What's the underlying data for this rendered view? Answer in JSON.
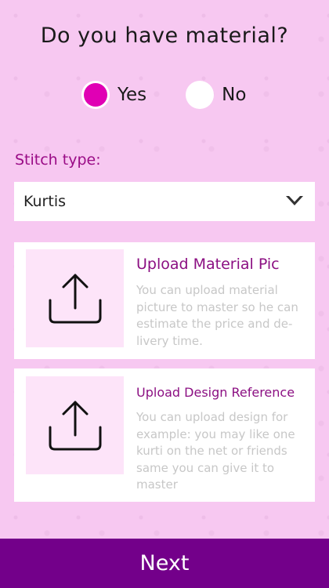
{
  "question": "Do you have material?",
  "radio": {
    "options": [
      {
        "label": "Yes",
        "selected": true
      },
      {
        "label": "No",
        "selected": false
      }
    ]
  },
  "stitch": {
    "label": "Stitch type:",
    "selected_value": "Kurtis"
  },
  "cards": [
    {
      "title": "Upload Material Pic",
      "description": "You can upload material picture to master so he can estimate the price and de-livery time.",
      "icon": "upload-icon"
    },
    {
      "title": "Upload Design Reference",
      "description": "You can upload design for example:  you may like one kurti on the net or friends same you can give it to master",
      "icon": "upload-icon"
    }
  ],
  "next_button": "Next",
  "colors": {
    "background": "#f7c8f1",
    "accent": "#e000b4",
    "label_purple": "#9a0c86",
    "button": "#73008a",
    "upload_box": "#fde4f9"
  }
}
